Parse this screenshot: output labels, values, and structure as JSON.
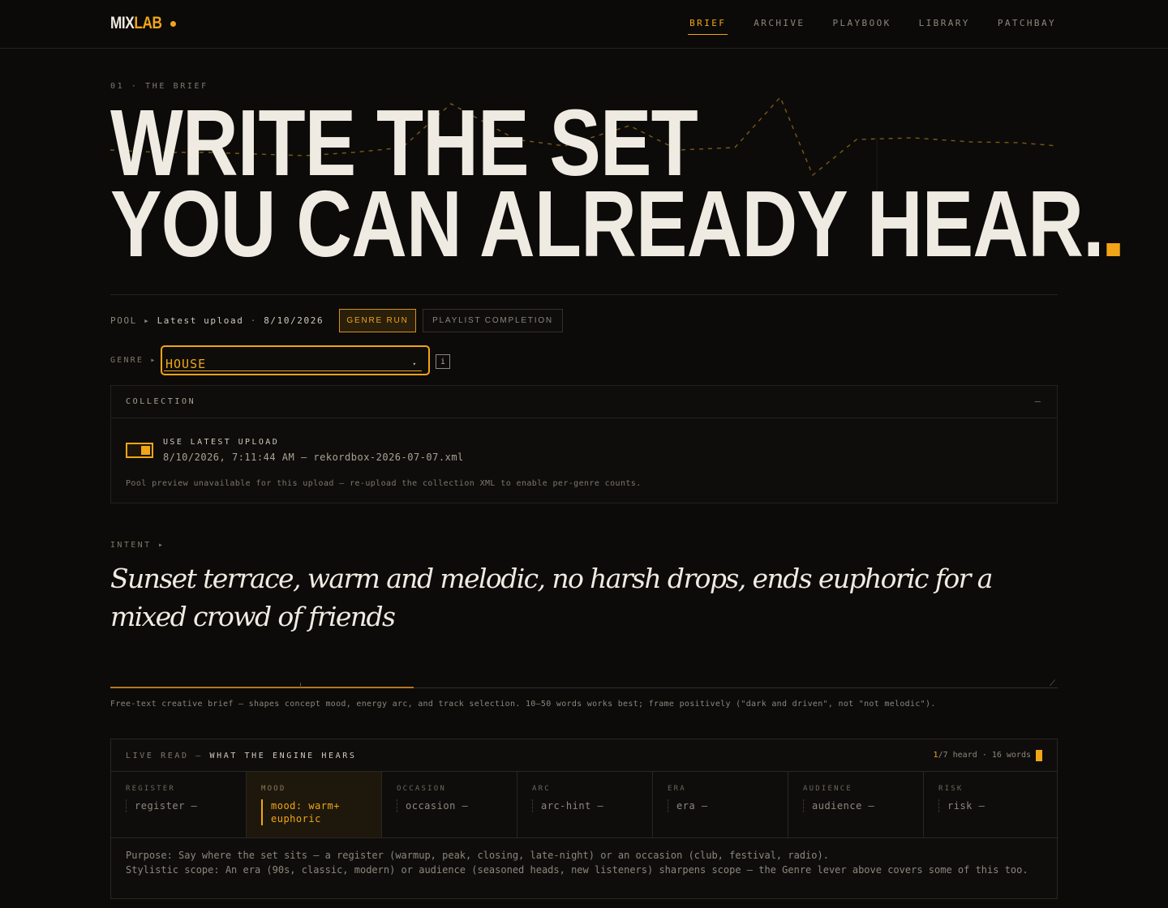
{
  "header": {
    "logo_mix": "MIX",
    "logo_lab": "LAB",
    "nav": [
      "BRIEF",
      "ARCHIVE",
      "PLAYBOOK",
      "LIBRARY",
      "PATCHBAY"
    ],
    "active_nav": "BRIEF"
  },
  "hero": {
    "eyebrow": "01 · THE BRIEF",
    "line1": "WRITE THE SET",
    "line2": "YOU CAN ALREADY HEAR"
  },
  "pool": {
    "label": "POOL ▸",
    "latest": "Latest upload",
    "sep": "·",
    "date": "8/10/2026",
    "modes": [
      "GENRE RUN",
      "PLAYLIST COMPLETION"
    ],
    "active_mode": "GENRE RUN"
  },
  "genre": {
    "label": "GENRE ▸",
    "value": "HOUSE",
    "info": "i"
  },
  "collection": {
    "title": "COLLECTION",
    "collapse": "—",
    "toggle_label": "USE LATEST UPLOAD",
    "toggle_on": true,
    "upload_meta": "8/10/2026, 7:11:44 AM — rekordbox-2026-07-07.xml",
    "note": "Pool preview unavailable for this upload — re-upload the collection XML to enable per-genre counts."
  },
  "intent": {
    "label": "INTENT ▸",
    "text": "Sunset terrace, warm and melodic, no harsh drops, ends euphoric for a mixed crowd of friends",
    "helper": "Free-text creative brief — shapes concept mood, energy arc, and track selection. 10–50 words works best; frame positively (\"dark and driven\", not \"not melodic\")."
  },
  "live_read": {
    "title_a": "LIVE READ —",
    "title_b": "WHAT THE ENGINE HEARS",
    "heard": "1",
    "total": "/7 heard",
    "words": "· 16 words",
    "cells": [
      {
        "label": "REGISTER",
        "value": "register —",
        "active": false
      },
      {
        "label": "MOOD",
        "value": "mood: warm+ euphoric",
        "active": true
      },
      {
        "label": "OCCASION",
        "value": "occasion —",
        "active": false
      },
      {
        "label": "ARC",
        "value": "arc-hint —",
        "active": false
      },
      {
        "label": "ERA",
        "value": "era —",
        "active": false
      },
      {
        "label": "AUDIENCE",
        "value": "audience —",
        "active": false
      },
      {
        "label": "RISK",
        "value": "risk —",
        "active": false
      }
    ],
    "purpose_1": "Purpose: Say where the set sits — a register (warmup, peak, closing, late-night) or an occasion (club, festival, radio).",
    "purpose_2": "Stylistic scope: An era (90s, classic, modern) or audience (seasoned heads, new listeners) sharpens scope — the Genre lever above covers some of this too."
  },
  "colors": {
    "accent": "#f2a516",
    "background": "#0c0b09",
    "text": "#efebe2"
  }
}
